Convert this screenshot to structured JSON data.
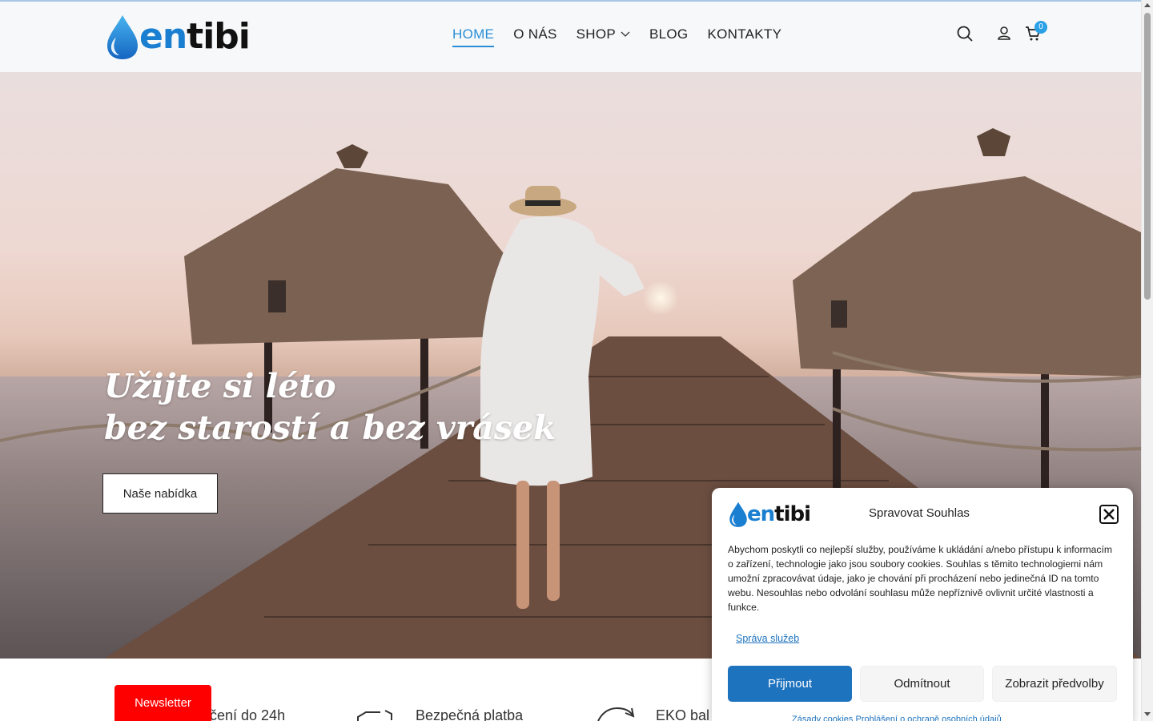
{
  "brand": {
    "logo_en": "en",
    "logo_tibi": "tibi",
    "accent_color": "#1a7fd1"
  },
  "nav": {
    "items": [
      {
        "label": "HOME",
        "active": true
      },
      {
        "label": "O NÁS",
        "active": false
      },
      {
        "label": "SHOP",
        "active": false,
        "has_dropdown": true
      },
      {
        "label": "BLOG",
        "active": false
      },
      {
        "label": "KONTAKTY",
        "active": false
      }
    ]
  },
  "header": {
    "icons": [
      "search-icon",
      "user-icon",
      "cart-icon"
    ],
    "cart_count": "0"
  },
  "hero": {
    "title_line1": "Užijte si léto",
    "title_line2": "bez starostí a bez vrásek",
    "cta_label": "Naše nabídka"
  },
  "features": [
    {
      "label": "čení do 24h"
    },
    {
      "label": "Bezpečná platba"
    },
    {
      "label": "EKO bal"
    }
  ],
  "newsletter": {
    "label": "Newsletter",
    "color": "#ff0000"
  },
  "cookie": {
    "title": "Spravovat Souhlas",
    "body": "Abychom poskytli co nejlepší služby, používáme k ukládání a/nebo přístupu k informacím o zařízení, technologie jako jsou soubory cookies. Souhlas s těmito technologiemi nám umožní zpracovávat údaje, jako je chování při procházení nebo jedinečná ID na tomto webu. Nesouhlas nebo odvolání souhlasu může nepříznivě ovlivnit určité vlastnosti a funkce.",
    "manage_link": "Správa služeb",
    "accept_label": "Přijmout",
    "deny_label": "Odmítnout",
    "prefs_label": "Zobrazit předvolby",
    "footer_links": "Zásady cookies   Prohlášení o ochraně osobních údajů",
    "accept_color": "#1e73be"
  }
}
